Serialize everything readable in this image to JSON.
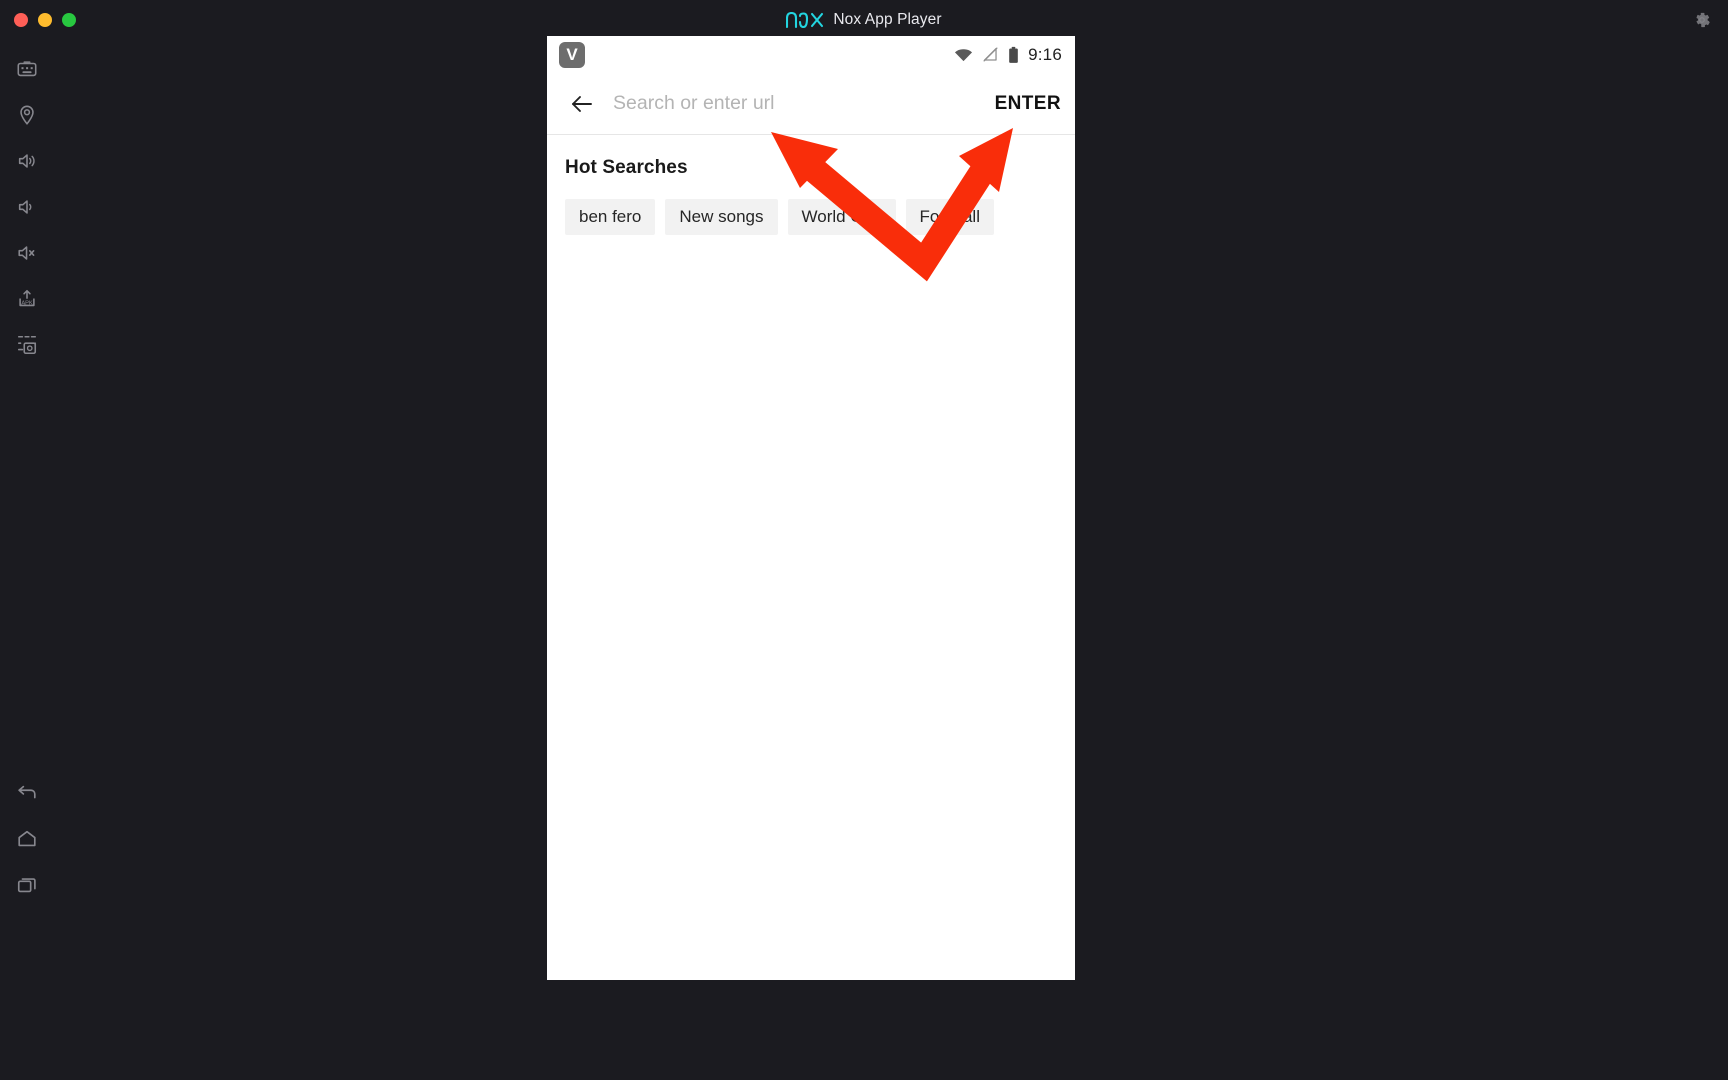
{
  "window": {
    "title": "Nox App Player",
    "logo_text": "nox",
    "logo_color": "#23d5e0",
    "controls": [
      {
        "name": "close",
        "color": "#ff5f57"
      },
      {
        "name": "minimize",
        "color": "#febc2e"
      },
      {
        "name": "maximize",
        "color": "#28c840"
      }
    ],
    "settings_icon": "gear-icon",
    "background": "#1b1b20"
  },
  "sidebar": {
    "top_items": [
      {
        "icon": "keyboard-icon",
        "label": "Keyboard control"
      },
      {
        "icon": "location-icon",
        "label": "Location"
      },
      {
        "icon": "volume-up-icon",
        "label": "Volume up"
      },
      {
        "icon": "volume-down-icon",
        "label": "Volume down"
      },
      {
        "icon": "volume-mute-icon",
        "label": "Mute"
      },
      {
        "icon": "apk-install-icon",
        "label": "Install APK"
      },
      {
        "icon": "screenshot-icon",
        "label": "Screenshot"
      }
    ],
    "bottom_items": [
      {
        "icon": "back-icon",
        "label": "Back"
      },
      {
        "icon": "home-icon",
        "label": "Home"
      },
      {
        "icon": "recents-icon",
        "label": "Recent apps"
      }
    ]
  },
  "phone": {
    "statusbar": {
      "app_badge_letter": "V",
      "icons": [
        "wifi-icon",
        "signal-off-icon",
        "battery-icon"
      ],
      "time": "9:16"
    },
    "searchbar": {
      "back_icon": "arrow-left-icon",
      "input_value": "",
      "placeholder": "Search or enter url",
      "enter_label": "ENTER"
    },
    "content": {
      "section_title": "Hot Searches",
      "chips": [
        "ben fero",
        "New songs",
        "World Cup",
        "Football"
      ]
    }
  },
  "annotation": {
    "type": "double-arrow-v",
    "color": "#f92d0a",
    "targets": [
      "search-input",
      "enter-button"
    ]
  }
}
